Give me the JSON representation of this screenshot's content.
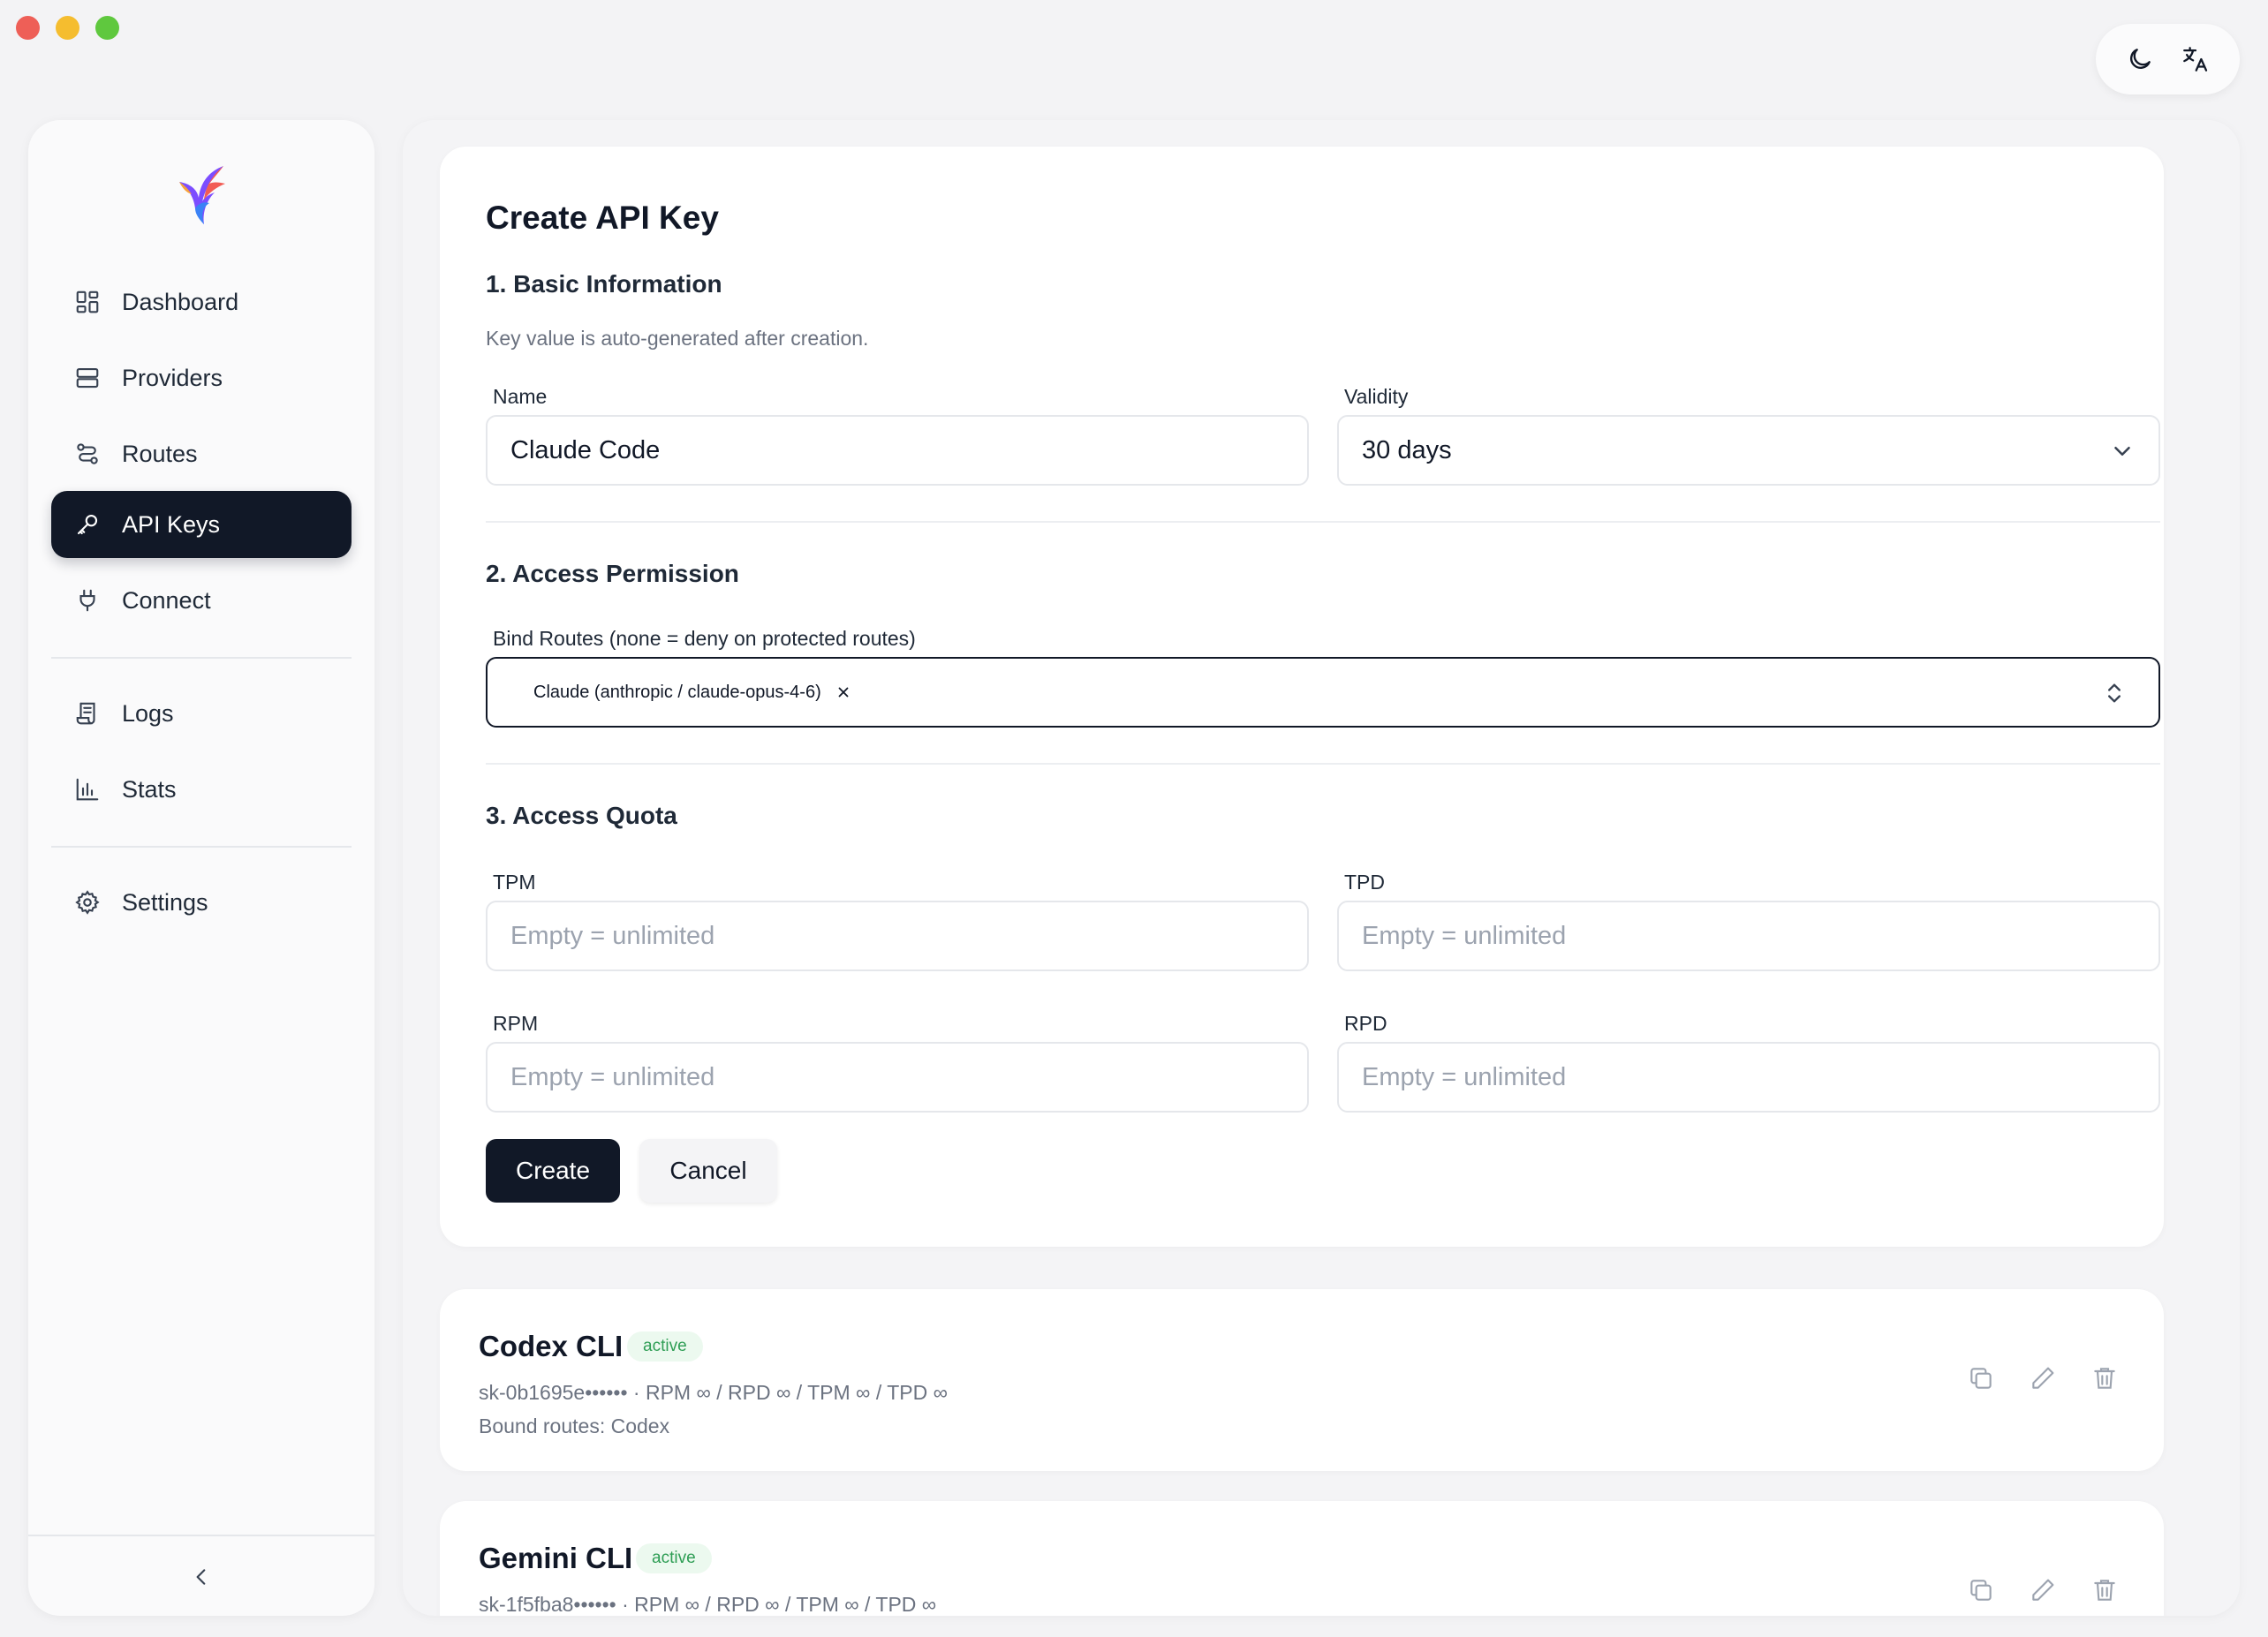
{
  "toolbar": {
    "theme_icon": "moon-icon",
    "language_icon": "translate-icon"
  },
  "sidebar": {
    "items": [
      {
        "label": "Dashboard",
        "icon": "dashboard-icon"
      },
      {
        "label": "Providers",
        "icon": "server-icon"
      },
      {
        "label": "Routes",
        "icon": "routes-icon"
      },
      {
        "label": "API Keys",
        "icon": "key-icon",
        "active": true
      },
      {
        "label": "Connect",
        "icon": "plug-icon"
      },
      {
        "label": "Logs",
        "icon": "logs-icon"
      },
      {
        "label": "Stats",
        "icon": "bar-chart-icon"
      },
      {
        "label": "Settings",
        "icon": "gear-icon"
      }
    ],
    "collapse_icon": "chevron-left-icon"
  },
  "create_form": {
    "title": "Create API Key",
    "section1": {
      "title": "1. Basic Information",
      "help": "Key value is auto-generated after creation.",
      "name_label": "Name",
      "name_value": "Claude Code",
      "validity_label": "Validity",
      "validity_value": "30 days"
    },
    "section2": {
      "title": "2. Access Permission",
      "routes_label": "Bind Routes (none = deny on protected routes)",
      "selected_route": "Claude (anthropic / claude-opus-4-6)"
    },
    "section3": {
      "title": "3. Access Quota",
      "tpm_label": "TPM",
      "tpd_label": "TPD",
      "rpm_label": "RPM",
      "rpd_label": "RPD",
      "placeholder": "Empty = unlimited"
    },
    "create_label": "Create",
    "cancel_label": "Cancel"
  },
  "keys": [
    {
      "name": "Codex CLI",
      "status": "active",
      "meta": "sk-0b1695e•••••• · RPM ∞ / RPD ∞ / TPM ∞ / TPD ∞",
      "routes": "Bound routes: Codex"
    },
    {
      "name": "Gemini CLI",
      "status": "active",
      "meta": "sk-1f5fba8•••••• · RPM ∞ / RPD ∞ / TPM ∞ / TPD ∞"
    }
  ],
  "colors": {
    "primary": "#111827",
    "active_badge_bg": "#ecf9ef",
    "active_badge_text": "#2f9e55"
  }
}
